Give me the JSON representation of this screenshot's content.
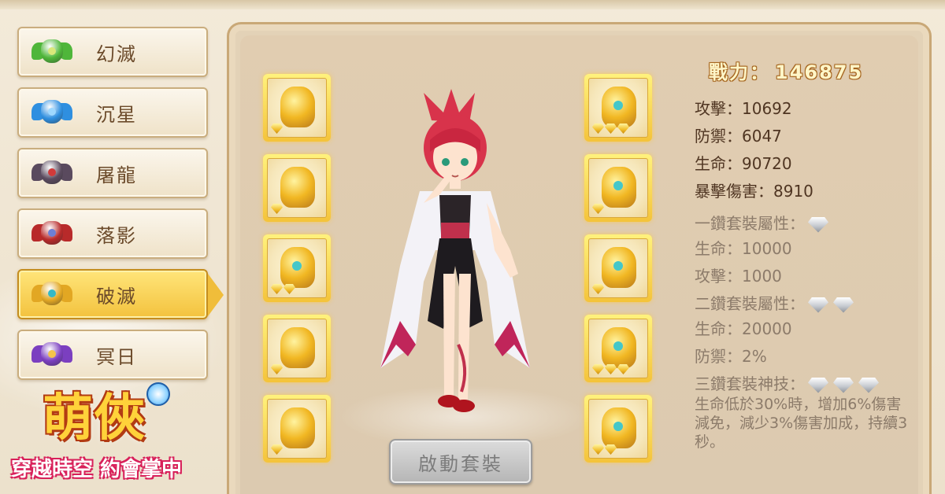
{
  "sidebar": {
    "items": [
      {
        "label": "幻滅",
        "icon": "green-armor-icon",
        "color": "#4fb63a",
        "accent": "#d9e87a",
        "active": false
      },
      {
        "label": "沉星",
        "icon": "blue-armor-icon",
        "color": "#2f8fe0",
        "accent": "#9fd8ff",
        "active": false
      },
      {
        "label": "屠龍",
        "icon": "dark-armor-icon",
        "color": "#5a4a5e",
        "accent": "#d13a3a",
        "active": false
      },
      {
        "label": "落影",
        "icon": "red-armor-icon",
        "color": "#b82a2a",
        "accent": "#6d7fd6",
        "active": false
      },
      {
        "label": "破滅",
        "icon": "gold-armor-icon",
        "color": "#e2a723",
        "accent": "#35b9c7",
        "active": true
      },
      {
        "label": "冥日",
        "icon": "purple-armor-icon",
        "color": "#7b3fc0",
        "accent": "#f5c64a",
        "active": false
      }
    ]
  },
  "equipment": {
    "left": [
      {
        "name": "weapon-slot",
        "icon": "golden-sword-icon",
        "diamonds": 1
      },
      {
        "name": "necklace-slot",
        "icon": "golden-necklace-icon",
        "diamonds": 1
      },
      {
        "name": "ring-slot",
        "icon": "golden-ring-icon",
        "diamonds": 2
      },
      {
        "name": "amulet-slot",
        "icon": "golden-amulet-icon",
        "diamonds": 1
      },
      {
        "name": "bracelet-slot",
        "icon": "golden-bracelet-icon",
        "diamonds": 1
      }
    ],
    "right": [
      {
        "name": "helmet-slot",
        "icon": "golden-helmet-icon",
        "diamonds": 3
      },
      {
        "name": "armor-slot",
        "icon": "golden-armor-icon",
        "diamonds": 1
      },
      {
        "name": "gauntlet-slot",
        "icon": "golden-gauntlet-icon",
        "diamonds": 1
      },
      {
        "name": "leggings-slot",
        "icon": "golden-leggings-icon",
        "diamonds": 3
      },
      {
        "name": "boots-slot",
        "icon": "golden-boots-icon",
        "diamonds": 2
      }
    ]
  },
  "activate_button": {
    "label": "啟動套裝"
  },
  "stats": {
    "power_label": "戰力：",
    "power_value": "146875",
    "attack": "攻擊：10692",
    "defense": "防禦：6047",
    "hp": "生命：90720",
    "crit": "暴擊傷害：8910",
    "set1_title": "一鑽套裝屬性：",
    "set1_hp": "生命：10000",
    "set1_attack": "攻擊：1000",
    "set2_title": "二鑽套裝屬性：",
    "set2_hp": "生命：20000",
    "set2_defense": "防禦：2%",
    "set3_title": "三鑽套裝神技：",
    "set3_desc": "生命低於30%時，增加6%傷害減免，減少3%傷害加成，持續3秒。"
  },
  "logo": {
    "title": "萌俠",
    "subtitle": "穿越時空 約會掌中"
  },
  "colors": {
    "gold": "#f4c33a",
    "panel": "#e1cdb1",
    "text_dark": "#4f3522",
    "text_dim": "#8c7b6a"
  }
}
